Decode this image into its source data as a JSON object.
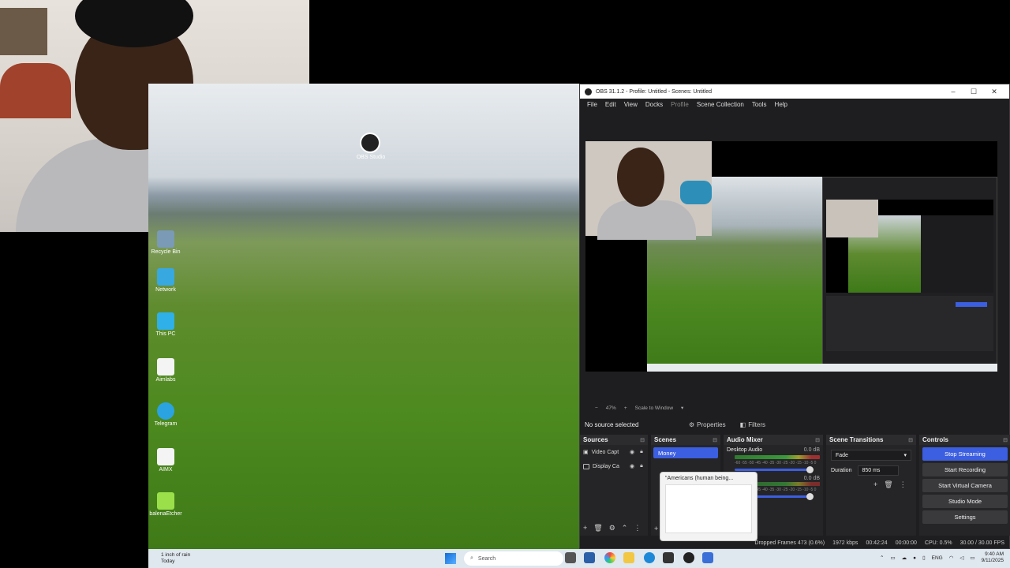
{
  "desktop": {
    "icons": [
      {
        "label": "Recycle Bin",
        "color": "#7a9ab5"
      },
      {
        "label": "Network",
        "color": "#38a8e0"
      },
      {
        "label": "This PC",
        "color": "#2fb0e8"
      },
      {
        "label": "Aimlabs",
        "color": "#f4f4f4"
      },
      {
        "label": "Telegram",
        "color": "#2aa3e0"
      },
      {
        "label": "AIMX",
        "color": "#f4f4f4"
      },
      {
        "label": "balenaEtcher",
        "color": "#9be04a"
      }
    ],
    "obs_shortcut_label": "OBS Studio"
  },
  "obs": {
    "title": "OBS 31.1.2 - Profile: Untitled - Scenes: Untitled",
    "menu": [
      "File",
      "Edit",
      "View",
      "Docks",
      "Profile",
      "Scene Collection",
      "Tools",
      "Help"
    ],
    "zoom": "47%",
    "scale_mode": "Scale to Window",
    "no_source": "No source selected",
    "properties_label": "Properties",
    "filters_label": "Filters",
    "docks": {
      "sources": {
        "title": "Sources",
        "items": [
          "Video Capt",
          "Display Ca"
        ]
      },
      "scenes": {
        "title": "Scenes",
        "items": [
          "Money"
        ]
      },
      "mixer": {
        "title": "Audio Mixer",
        "tracks": [
          {
            "name": "Desktop Audio",
            "db": "0.0 dB"
          },
          {
            "name": "",
            "db": "0.0 dB"
          }
        ],
        "scale": "-60 -55 -50 -45 -40 -35 -30 -25 -20 -15 -10 -5 0"
      },
      "transitions": {
        "title": "Scene Transitions",
        "type": "Fade",
        "duration_label": "Duration",
        "duration_value": "850 ms"
      },
      "controls": {
        "title": "Controls",
        "buttons": [
          "Stop Streaming",
          "Start Recording",
          "Start Virtual Camera",
          "Studio Mode",
          "Settings"
        ]
      }
    },
    "status": {
      "dropped": "Dropped Frames 473 (0.6%)",
      "bitrate": "1972 kbps",
      "stream_time": "00:42:24",
      "rec_time": "00:00:00",
      "cpu": "CPU: 0.5%",
      "fps": "30.00 / 30.00 FPS"
    }
  },
  "notification": {
    "title": "\"Americans (human being..."
  },
  "taskbar": {
    "weather_line1": "1 inch of rain",
    "weather_line2": "Today",
    "search_placeholder": "Search",
    "lang": "ENG",
    "time": "9:40 AM",
    "date": "9/11/2025"
  },
  "colors": {
    "accent": "#3c5ee0"
  }
}
